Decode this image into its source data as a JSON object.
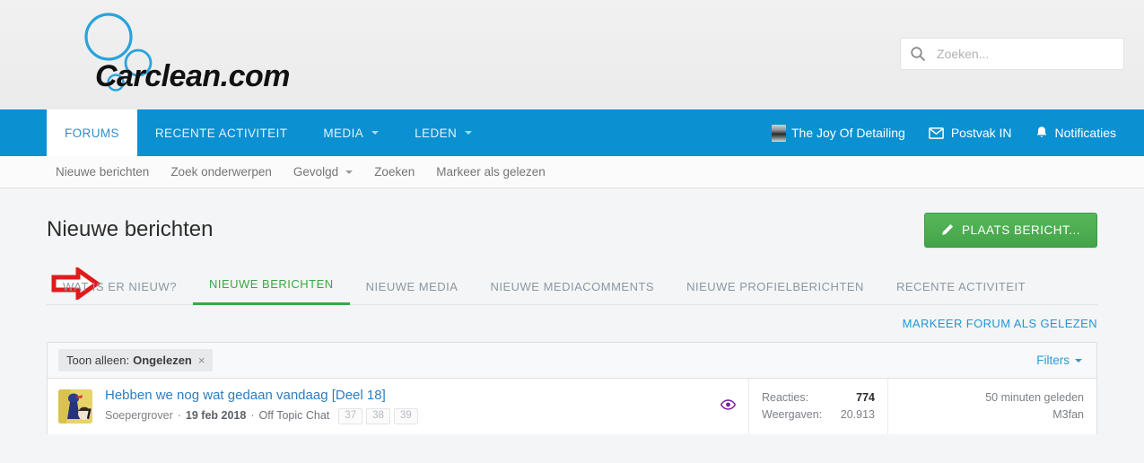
{
  "site": {
    "logo_text": "Carclean.com",
    "logo_color": "#29a3db"
  },
  "search": {
    "placeholder": "Zoeken...",
    "value": "",
    "icon": "search-icon"
  },
  "nav": {
    "items": [
      {
        "label": "FORUMS",
        "active": true,
        "has_dropdown": false
      },
      {
        "label": "RECENTE ACTIVITEIT",
        "active": false,
        "has_dropdown": false
      },
      {
        "label": "MEDIA",
        "active": false,
        "has_dropdown": true
      },
      {
        "label": "LEDEN",
        "active": false,
        "has_dropdown": true
      }
    ],
    "right": [
      {
        "label": "The Joy Of Detailing",
        "icon": "user-avatar-icon"
      },
      {
        "label": "Postvak IN",
        "icon": "envelope-icon"
      },
      {
        "label": "Notificaties",
        "icon": "bell-icon"
      }
    ],
    "bg_color": "#0b90d2"
  },
  "subnav": {
    "items": [
      {
        "label": "Nieuwe berichten",
        "has_dropdown": false
      },
      {
        "label": "Zoek onderwerpen",
        "has_dropdown": false
      },
      {
        "label": "Gevolgd",
        "has_dropdown": true
      },
      {
        "label": "Zoeken",
        "has_dropdown": false
      },
      {
        "label": "Markeer als gelezen",
        "has_dropdown": false
      }
    ]
  },
  "page": {
    "title": "Nieuwe berichten",
    "post_button": "PLAATS BERICHT...",
    "post_button_color": "#4caf50",
    "mark_forum_read": "MARKEER FORUM ALS GELEZEN"
  },
  "tabs": {
    "items": [
      {
        "label": "WAT IS ER NIEUW?",
        "active": false
      },
      {
        "label": "NIEUWE BERICHTEN",
        "active": true
      },
      {
        "label": "NIEUWE MEDIA",
        "active": false
      },
      {
        "label": "NIEUWE MEDIACOMMENTS",
        "active": false
      },
      {
        "label": "NIEUWE PROFIELBERICHTEN",
        "active": false
      },
      {
        "label": "RECENTE ACTIVITEIT",
        "active": false
      }
    ],
    "active_color": "#3aa845"
  },
  "annotation": {
    "shape": "right-arrow",
    "color": "#e01b1b",
    "points_to": "WAT IS ER NIEUW?"
  },
  "filter_bar": {
    "chip_prefix": "Toon alleen:",
    "chip_value": "Ongelezen",
    "chip_close": "×",
    "filters_label": "Filters"
  },
  "threads": [
    {
      "title": "Hebben we nog wat gedaan vandaag [Deel 18]",
      "author": "Soepergrover",
      "date": "19 feb 2018",
      "node": "Off Topic Chat",
      "pages": [
        "37",
        "38",
        "39"
      ],
      "watched_icon": "eye-icon",
      "watched_icon_color": "#7b1fa2",
      "stats": [
        {
          "label": "Reacties:",
          "value": "774",
          "emphasis": true
        },
        {
          "label": "Weergaven:",
          "value": "20.913",
          "emphasis": false
        }
      ],
      "last_time": "50 minuten geleden",
      "last_user": "M3fan"
    }
  ]
}
